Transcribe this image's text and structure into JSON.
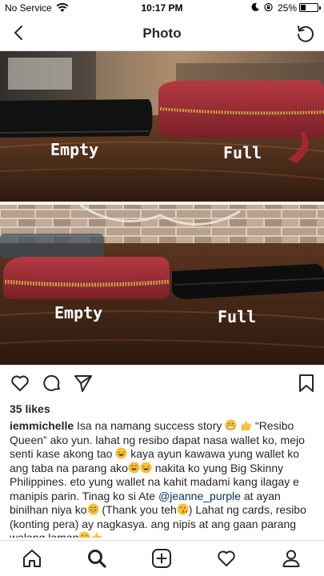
{
  "status": {
    "carrier": "No Service",
    "time": "10:17 PM",
    "battery": "25%",
    "battery_level": 0.25
  },
  "nav": {
    "title": "Photo",
    "back_icon": "chevron-left-icon",
    "right_icon": "refresh-icon"
  },
  "photo": {
    "top_left_label": "Empty",
    "top_right_label": "Full",
    "bottom_left_label": "Empty",
    "bottom_right_label": "Full"
  },
  "actions": {
    "icons": [
      "heart-icon",
      "comment-icon",
      "share-icon",
      "bookmark-icon"
    ]
  },
  "post": {
    "likes": "35 likes",
    "username": "iemmichelle",
    "caption_1": " Isa na namang success story",
    "caption_2": " “Resibo Queen” ako yun. lahat ng resibo dapat nasa wallet ko, mejo senti kase akong tao ",
    "caption_3": " kaya ayun kawawa yung wallet ko ang taba na parang ako",
    "caption_4": " nakita ko yung Big Skinny Philippines. eto yung wallet na kahit madami kang ilagay e manipis parin. Tinag ko si Ate ",
    "mention": "@jeanne_purple",
    "caption_5": " at ayan binilhan niya ko",
    "caption_6": "  (Thank you teh",
    "caption_7": ") Lahat ng cards, resibo (konting pera) ay nagkasya. ang nipis at ang gaan parang walang laman"
  },
  "tabs": [
    "home-icon",
    "search-icon",
    "new-post-icon",
    "activity-icon",
    "profile-icon"
  ],
  "colors": {
    "text": "#262626",
    "divider": "#dbdbdb",
    "mention": "#003569",
    "wallet_red": "#9a2a31"
  }
}
